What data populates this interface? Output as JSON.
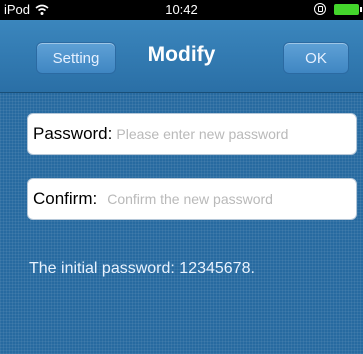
{
  "status_bar": {
    "carrier": "iPod",
    "time": "10:42",
    "icons": [
      "wifi-icon",
      "lock-icon",
      "battery-icon"
    ]
  },
  "nav": {
    "title": "Modify",
    "back_label": "Setting",
    "ok_label": "OK"
  },
  "form": {
    "password": {
      "label": "Password:",
      "placeholder": "Please enter new password",
      "value": ""
    },
    "confirm": {
      "label": "Confirm:",
      "placeholder": "Confirm the new password",
      "value": ""
    }
  },
  "info": {
    "text": "The initial password: 12345678."
  },
  "colors": {
    "nav_bar": "#2f78b0",
    "background": "#276aa0",
    "battery": "#44d62c"
  }
}
